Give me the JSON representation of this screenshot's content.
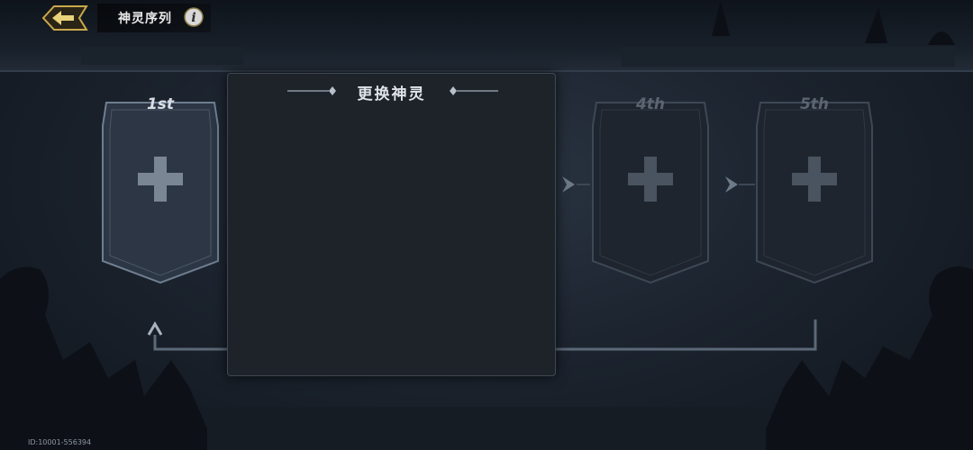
{
  "header": {
    "title": "神灵序列",
    "back_icon": "back-arrow-icon",
    "info_icon": "info-icon"
  },
  "slots": [
    {
      "label": "1st",
      "state": "active",
      "icon": "plus-icon"
    },
    {
      "label": "4th",
      "state": "locked",
      "icon": "plus-icon"
    },
    {
      "label": "5th",
      "state": "locked",
      "icon": "plus-icon"
    }
  ],
  "modal": {
    "title": "更换神灵"
  },
  "footer": {
    "player_id": "ID:10001-556394"
  },
  "colors": {
    "gold": "#c9a94a",
    "panel": "#1d2329",
    "card_active": "#2c3644",
    "card_dim": "#1e252e"
  }
}
